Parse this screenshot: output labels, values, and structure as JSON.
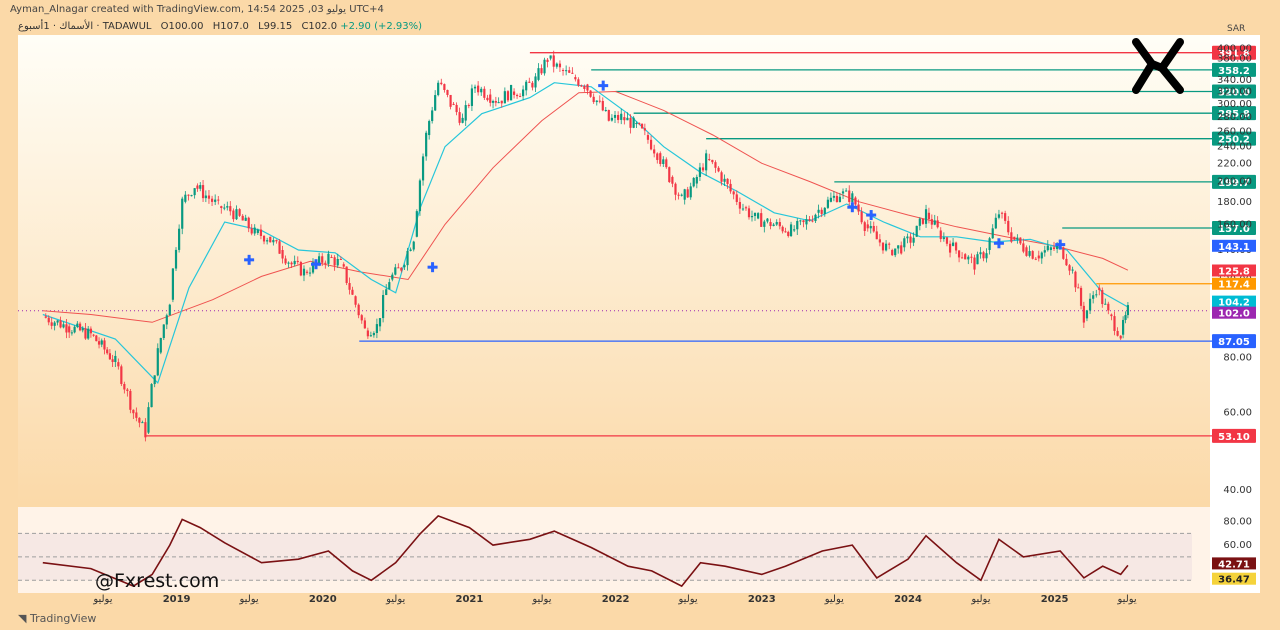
{
  "header": {
    "credit": "Ayman_Alnagar created with TradingView.com, 14:54 2025 ,03 يوليو UTC+4",
    "symbol": "الأسماك · 1أسبوع · TADAWUL",
    "open": "O100.00",
    "high": "H107.0",
    "low": "L99.15",
    "close": "C102.0",
    "change": "+2.90 (+2.93%)",
    "currency": "SAR"
  },
  "watermark": "@Fxrest.com",
  "footer_logo": "TradingView",
  "colors": {
    "background": "#fbd9a8",
    "up": "#089981",
    "down": "#f23645",
    "ema_fast": "#26c6da",
    "ema_slow": "#ef5350",
    "rsi": "#7a1113",
    "support_blue": "#2962ff",
    "resistance_green": "#089981",
    "red_level": "#f23645"
  },
  "chart_data": [
    {
      "type": "candlestick",
      "scale": "log",
      "ylim": [
        38,
        410
      ],
      "y_ticks": [
        40,
        60,
        80,
        100,
        120,
        140,
        160,
        180,
        200,
        220,
        240,
        260,
        280,
        300,
        320,
        340,
        380,
        400
      ],
      "y_tick_labels": [
        "40.00",
        "60.00",
        "80.00",
        "100.00",
        "120.00",
        "140.00",
        "160.00",
        "180.00",
        "200.00",
        "220.00",
        "240.00",
        "260.00",
        "280.00",
        "300.00",
        "320.00",
        "340.00",
        "380.00",
        "400.00"
      ],
      "x_labels": [
        "يوليو",
        "2019",
        "يوليو",
        "2020",
        "يوليو",
        "2021",
        "يوليو",
        "2022",
        "يوليو",
        "2023",
        "يوليو",
        "2024",
        "يوليو",
        "2025",
        "يوليو"
      ],
      "series_price": [
        [
          "2018-02-01",
          99
        ],
        [
          "2018-04-01",
          94
        ],
        [
          "2018-06-01",
          90
        ],
        [
          "2018-08-01",
          78
        ],
        [
          "2018-09-15",
          60
        ],
        [
          "2018-10-15",
          54
        ],
        [
          "2018-11-15",
          82
        ],
        [
          "2018-12-15",
          108
        ],
        [
          "2019-01-15",
          180
        ],
        [
          "2019-02-15",
          196
        ],
        [
          "2019-03-15",
          186
        ],
        [
          "2019-04-15",
          176
        ],
        [
          "2019-05-15",
          172
        ],
        [
          "2019-06-15",
          163
        ],
        [
          "2019-07-15",
          153
        ],
        [
          "2019-08-15",
          150
        ],
        [
          "2019-09-15",
          140
        ],
        [
          "2019-10-15",
          130
        ],
        [
          "2019-11-15",
          125
        ],
        [
          "2019-12-15",
          130
        ],
        [
          "2020-01-15",
          135
        ],
        [
          "2020-02-15",
          130
        ],
        [
          "2020-03-15",
          110
        ],
        [
          "2020-04-15",
          92
        ],
        [
          "2020-05-15",
          94
        ],
        [
          "2020-06-15",
          120
        ],
        [
          "2020-07-15",
          128
        ],
        [
          "2020-08-15",
          150
        ],
        [
          "2020-09-15",
          255
        ],
        [
          "2020-10-15",
          335
        ],
        [
          "2020-11-15",
          300
        ],
        [
          "2020-12-15",
          275
        ],
        [
          "2021-01-15",
          330
        ],
        [
          "2021-02-15",
          315
        ],
        [
          "2021-03-15",
          305
        ],
        [
          "2021-04-15",
          320
        ],
        [
          "2021-05-15",
          322
        ],
        [
          "2021-06-15",
          340
        ],
        [
          "2021-07-15",
          380
        ],
        [
          "2021-08-15",
          358
        ],
        [
          "2021-09-15",
          345
        ],
        [
          "2021-10-15",
          332
        ],
        [
          "2021-11-15",
          305
        ],
        [
          "2021-12-15",
          275
        ],
        [
          "2022-01-15",
          280
        ],
        [
          "2022-02-15",
          270
        ],
        [
          "2022-03-15",
          255
        ],
        [
          "2022-04-15",
          232
        ],
        [
          "2022-05-15",
          205
        ],
        [
          "2022-06-15",
          182
        ],
        [
          "2022-07-15",
          198
        ],
        [
          "2022-08-15",
          225
        ],
        [
          "2022-09-15",
          210
        ],
        [
          "2022-10-15",
          190
        ],
        [
          "2022-11-15",
          175
        ],
        [
          "2022-12-15",
          165
        ],
        [
          "2023-01-15",
          162
        ],
        [
          "2023-02-15",
          158
        ],
        [
          "2023-03-15",
          155
        ],
        [
          "2023-04-15",
          160
        ],
        [
          "2023-05-15",
          170
        ],
        [
          "2023-06-15",
          180
        ],
        [
          "2023-07-15",
          188
        ],
        [
          "2023-08-15",
          184
        ],
        [
          "2023-09-15",
          160
        ],
        [
          "2023-10-15",
          148
        ],
        [
          "2023-11-15",
          140
        ],
        [
          "2023-12-15",
          142
        ],
        [
          "2024-01-15",
          150
        ],
        [
          "2024-02-15",
          170
        ],
        [
          "2024-03-15",
          155
        ],
        [
          "2024-04-15",
          143
        ],
        [
          "2024-05-15",
          137
        ],
        [
          "2024-06-15",
          130
        ],
        [
          "2024-07-15",
          140
        ],
        [
          "2024-08-15",
          170
        ],
        [
          "2024-09-15",
          150
        ],
        [
          "2024-10-15",
          142
        ],
        [
          "2024-11-15",
          136
        ],
        [
          "2024-12-15",
          140
        ],
        [
          "2025-01-15",
          142
        ],
        [
          "2025-02-15",
          125
        ],
        [
          "2025-03-15",
          98
        ],
        [
          "2025-04-15",
          115
        ],
        [
          "2025-05-15",
          100
        ],
        [
          "2025-06-15",
          90
        ],
        [
          "2025-07-03",
          102
        ]
      ],
      "ema_fast": [
        [
          "2018-02-01",
          100
        ],
        [
          "2018-08-01",
          88
        ],
        [
          "2018-11-15",
          70
        ],
        [
          "2019-02-01",
          115
        ],
        [
          "2019-05-01",
          162
        ],
        [
          "2019-08-01",
          155
        ],
        [
          "2019-11-01",
          140
        ],
        [
          "2020-02-01",
          138
        ],
        [
          "2020-05-01",
          120
        ],
        [
          "2020-07-01",
          112
        ],
        [
          "2020-09-01",
          175
        ],
        [
          "2020-11-01",
          240
        ],
        [
          "2021-02-01",
          285
        ],
        [
          "2021-06-01",
          310
        ],
        [
          "2021-08-01",
          335
        ],
        [
          "2021-11-01",
          328
        ],
        [
          "2022-02-01",
          285
        ],
        [
          "2022-05-01",
          240
        ],
        [
          "2022-08-01",
          210
        ],
        [
          "2022-11-01",
          190
        ],
        [
          "2023-02-01",
          170
        ],
        [
          "2023-05-01",
          163
        ],
        [
          "2023-08-01",
          178
        ],
        [
          "2023-11-01",
          162
        ],
        [
          "2024-02-01",
          150
        ],
        [
          "2024-05-01",
          150
        ],
        [
          "2024-08-01",
          146
        ],
        [
          "2024-11-01",
          148
        ],
        [
          "2025-02-01",
          140
        ],
        [
          "2025-05-01",
          112
        ],
        [
          "2025-07-03",
          104
        ]
      ],
      "ema_slow": [
        [
          "2018-02-01",
          102
        ],
        [
          "2018-06-01",
          100
        ],
        [
          "2018-11-01",
          96
        ],
        [
          "2019-04-01",
          108
        ],
        [
          "2019-08-01",
          122
        ],
        [
          "2019-12-01",
          132
        ],
        [
          "2020-04-01",
          125
        ],
        [
          "2020-08-01",
          120
        ],
        [
          "2020-11-01",
          160
        ],
        [
          "2021-03-01",
          215
        ],
        [
          "2021-07-01",
          275
        ],
        [
          "2021-10-01",
          318
        ],
        [
          "2022-01-01",
          320
        ],
        [
          "2022-05-01",
          290
        ],
        [
          "2022-09-01",
          255
        ],
        [
          "2023-01-01",
          220
        ],
        [
          "2023-05-01",
          200
        ],
        [
          "2023-09-01",
          180
        ],
        [
          "2024-01-01",
          168
        ],
        [
          "2024-05-01",
          158
        ],
        [
          "2024-09-01",
          150
        ],
        [
          "2025-01-01",
          143
        ],
        [
          "2025-05-01",
          134
        ],
        [
          "2025-07-03",
          126
        ]
      ],
      "levels": [
        {
          "value": 391.8,
          "label": "391.8",
          "color": "#f23645"
        },
        {
          "value": 358.2,
          "label": "358.2",
          "color": "#089981"
        },
        {
          "value": 320.0,
          "label": "320.0",
          "color": "#089981"
        },
        {
          "value": 285.8,
          "label": "285.8",
          "color": "#089981"
        },
        {
          "value": 250.2,
          "label": "250.2",
          "color": "#089981"
        },
        {
          "value": 199.7,
          "label": "199.7",
          "color": "#089981"
        },
        {
          "value": 157.0,
          "label": "157.0",
          "color": "#089981"
        },
        {
          "value": 87.05,
          "label": "87.05",
          "color": "#2962ff"
        },
        {
          "value": 53.1,
          "label": "53.10",
          "color": "#f23645"
        }
      ],
      "price_badges": [
        {
          "value": 143.1,
          "label": "143.1",
          "color": "#2962ff"
        },
        {
          "value": 125.8,
          "label": "125.8",
          "color": "#f23645"
        },
        {
          "value": 117.4,
          "label": "117.4",
          "color": "#ff9800"
        },
        {
          "value": 104.2,
          "label": "104.2",
          "color": "#00bcd4"
        },
        {
          "value": 102.0,
          "label": "102.0",
          "color": "#9c27b0"
        }
      ],
      "cross_markers": [
        [
          "2019-07-01",
          133
        ],
        [
          "2019-12-15",
          130
        ],
        [
          "2020-10-01",
          128
        ],
        [
          "2021-12-01",
          330
        ],
        [
          "2023-08-15",
          175
        ],
        [
          "2023-10-01",
          168
        ],
        [
          "2024-08-15",
          145
        ],
        [
          "2025-01-15",
          144
        ]
      ]
    },
    {
      "type": "line",
      "ylim": [
        20,
        90
      ],
      "y_ticks": [
        40,
        60,
        80
      ],
      "y_tick_labels": [
        "",
        "60.00",
        "80.00"
      ],
      "guides": [
        70,
        50,
        30
      ],
      "series": [
        [
          "2018-02-01",
          45
        ],
        [
          "2018-06-01",
          40
        ],
        [
          "2018-09-15",
          25
        ],
        [
          "2018-11-01",
          35
        ],
        [
          "2018-12-15",
          60
        ],
        [
          "2019-01-15",
          82
        ],
        [
          "2019-03-01",
          75
        ],
        [
          "2019-05-01",
          62
        ],
        [
          "2019-08-01",
          45
        ],
        [
          "2019-11-01",
          48
        ],
        [
          "2020-01-15",
          55
        ],
        [
          "2020-03-15",
          38
        ],
        [
          "2020-05-01",
          30
        ],
        [
          "2020-07-01",
          45
        ],
        [
          "2020-09-01",
          70
        ],
        [
          "2020-10-15",
          85
        ],
        [
          "2021-01-01",
          75
        ],
        [
          "2021-03-01",
          60
        ],
        [
          "2021-06-01",
          65
        ],
        [
          "2021-08-01",
          72
        ],
        [
          "2021-11-01",
          58
        ],
        [
          "2022-02-01",
          42
        ],
        [
          "2022-04-01",
          38
        ],
        [
          "2022-06-15",
          25
        ],
        [
          "2022-08-01",
          45
        ],
        [
          "2022-10-01",
          42
        ],
        [
          "2023-01-01",
          35
        ],
        [
          "2023-03-01",
          42
        ],
        [
          "2023-06-01",
          55
        ],
        [
          "2023-08-15",
          60
        ],
        [
          "2023-10-15",
          32
        ],
        [
          "2024-01-01",
          48
        ],
        [
          "2024-02-15",
          68
        ],
        [
          "2024-05-01",
          45
        ],
        [
          "2024-07-01",
          30
        ],
        [
          "2024-08-15",
          65
        ],
        [
          "2024-10-15",
          50
        ],
        [
          "2025-01-15",
          55
        ],
        [
          "2025-03-15",
          32
        ],
        [
          "2025-05-01",
          42
        ],
        [
          "2025-06-15",
          35
        ],
        [
          "2025-07-03",
          42.71
        ]
      ],
      "badges": [
        {
          "value": 42.71,
          "label": "42.71",
          "color": "#7a1113"
        },
        {
          "value": 36.47,
          "label": "36.47",
          "color": "#f5d33b"
        }
      ]
    }
  ]
}
